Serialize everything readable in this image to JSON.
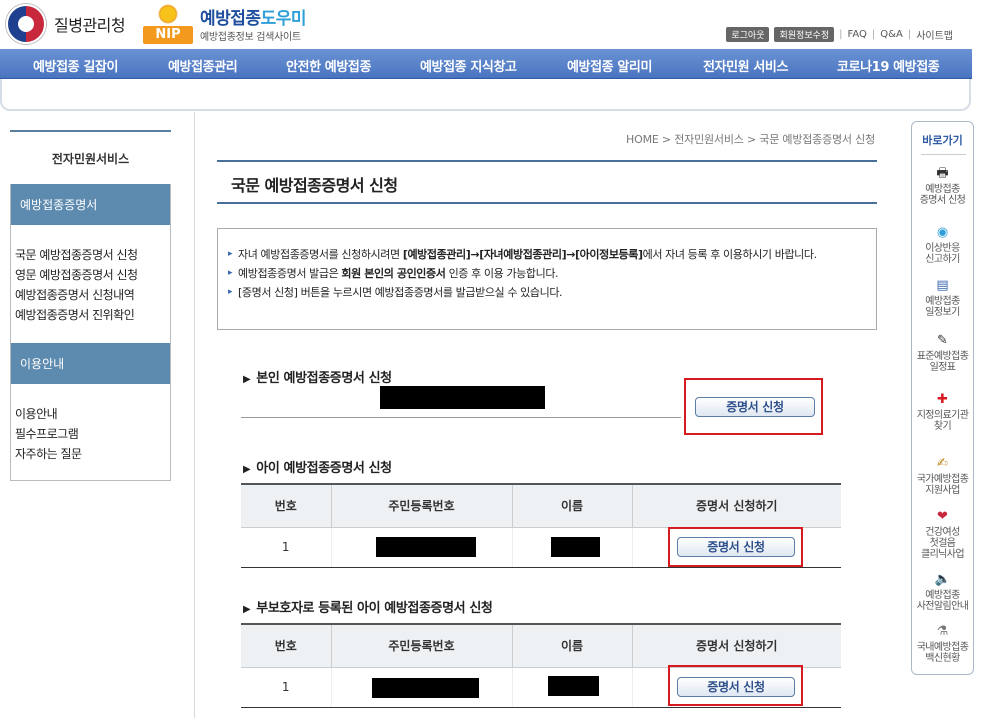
{
  "header": {
    "agency_name": "질병관리청",
    "nip_letters": "NIP",
    "site_title_main": "예방접종",
    "site_title_accent": "도우미",
    "site_subtitle": "예방접종정보 검색사이트",
    "util": {
      "logout": "로그아웃",
      "member_edit": "회원정보수정",
      "faq": "FAQ",
      "qna": "Q&A",
      "sitemap": "사이트맵"
    }
  },
  "gnb": [
    "예방접종 길잡이",
    "예방접종관리",
    "안전한 예방접종",
    "예방접종 지식창고",
    "예방접종 알리미",
    "전자민원 서비스",
    "코로나19 예방접종"
  ],
  "lnb": {
    "title": "전자민원서비스",
    "section1": "예방접종증명서",
    "section1_items": [
      "국문 예방접종증명서 신청",
      "영문 예방접종증명서 신청",
      "예방접종증명서 신청내역",
      "예방접종증명서 진위확인"
    ],
    "section2": "이용안내",
    "section2_items": [
      "이용안내",
      "필수프로그램",
      "자주하는 질문"
    ]
  },
  "breadcrumb": "HOME > 전자민원서비스 > 국문 예방접종증명서 신청",
  "page_title": "국문 예방접종증명서 신청",
  "notice": {
    "line1_pre": "자녀 예방접종증명서를 신청하시려면 ",
    "line1_bold": "[예방접종관리]→[자녀예방접종관리]→[아이정보등록]",
    "line1_post": "에서 자녀 등록 후 이용하시기 바랍니다.",
    "line2_pre": "예방접종증명서 발급은 ",
    "line2_bold": "회원 본인의 공인인증서",
    "line2_post": " 인증 후 이용 가능합니다.",
    "line3": "[증명서 신청] 버튼을 누르시면 예방접종증명서를 발급받으실 수 있습니다."
  },
  "self_section": {
    "title": "본인 예방접종증명서 신청",
    "button": "증명서 신청"
  },
  "child_section": {
    "title": "아이 예방접종증명서 신청",
    "headers": [
      "번호",
      "주민등록번호",
      "이름",
      "증명서 신청하기"
    ],
    "rows": [
      {
        "no": "1",
        "button": "증명서 신청"
      }
    ]
  },
  "guardian_section": {
    "title": "부보호자로 등록된 아이 예방접종증명서 신청",
    "headers": [
      "번호",
      "주민등록번호",
      "이름",
      "증명서 신청하기"
    ],
    "rows": [
      {
        "no": "1",
        "button": "증명서 신청"
      }
    ]
  },
  "quick": {
    "title": "바로가기",
    "items": [
      {
        "label1": "예방접종",
        "label2": "증명서 신청",
        "icon": "printer-icon"
      },
      {
        "label1": "이상반응",
        "label2": "신고하기",
        "icon": "alert-icon"
      },
      {
        "label1": "예방접종",
        "label2": "일정보기",
        "icon": "calendar-icon"
      },
      {
        "label1": "표준예방접종",
        "label2": "일정표",
        "icon": "syringe-icon"
      },
      {
        "label1": "지정의료기관",
        "label2": "찾기",
        "icon": "hospital-icon"
      },
      {
        "label1": "국가예방접종",
        "label2": "지원사업",
        "icon": "document-icon"
      },
      {
        "label1": "건강여성",
        "label2": "첫걸음",
        "label3": "클리닉사업",
        "icon": "heart-icon"
      },
      {
        "label1": "예방접종",
        "label2": "사전알림안내",
        "icon": "speaker-icon"
      },
      {
        "label1": "국내예방접종",
        "label2": "백신현황",
        "icon": "vaccine-icon"
      }
    ]
  },
  "colors": {
    "brand_blue": "#4a74c0",
    "highlight_red": "#d71920",
    "lnb_section": "#5d8aaf"
  }
}
